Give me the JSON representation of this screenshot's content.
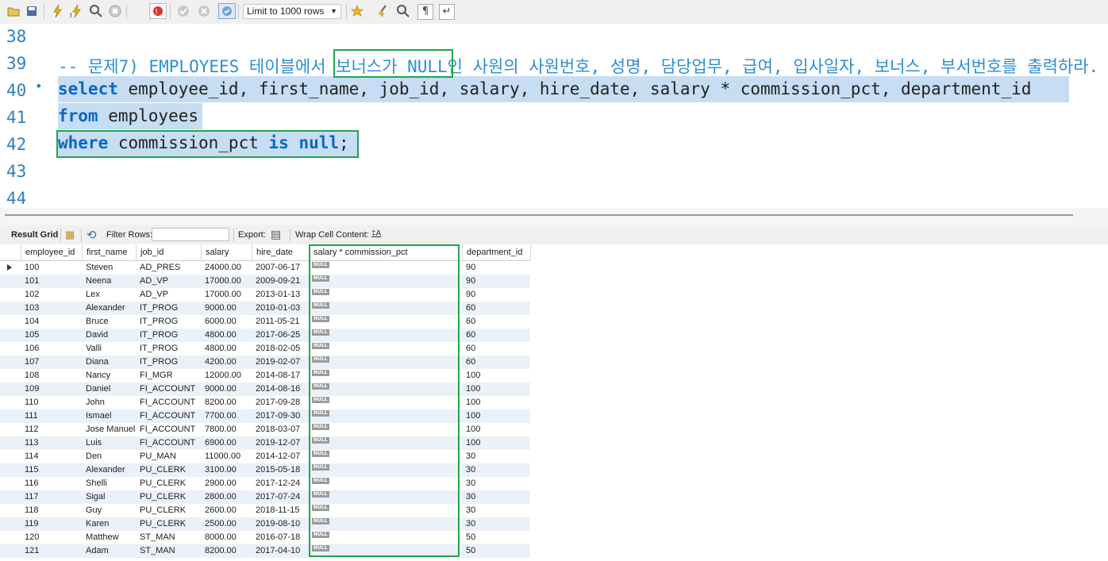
{
  "toolbar": {
    "limit_label": "Limit to 1000 rows",
    "icons": [
      "folder-open-icon",
      "save-icon",
      "execute-lightning-icon",
      "execute-cursor-lightning-icon",
      "explain-magnifier-icon",
      "stop-icon",
      "toggle-error-icon",
      "commit-check-icon",
      "rollback-x-icon",
      "autocommit-icon",
      "add-snippet-star-icon",
      "beautify-broom-icon",
      "find-icon",
      "invisible-chars-icon",
      "word-wrap-icon"
    ]
  },
  "editor": {
    "lines": [
      {
        "num": "38",
        "text": ""
      },
      {
        "num": "39",
        "text": "-- 문제7) EMPLOYEES 테이블에서 보너스가 NULL인 사원의 사원번호, 성명, 담당업무, 급여, 입사일자, 보너스, 부서번호를 출력하라."
      },
      {
        "num": "40",
        "kw": "select",
        "rest": " employee_id, first_name, job_id, salary, hire_date, salary * commission_pct, department_id"
      },
      {
        "num": "41",
        "kw": "from",
        "rest": " employees"
      },
      {
        "num": "42",
        "kw": "where",
        "mid": " commission_pct ",
        "kw2": "is",
        "sp": " ",
        "kw3": "null",
        "end": ";"
      },
      {
        "num": "43",
        "text": ""
      },
      {
        "num": "44",
        "text": ""
      }
    ]
  },
  "result_toolbar": {
    "result_grid": "Result Grid",
    "filter_rows": "Filter Rows:",
    "filter_value": "",
    "export": "Export:",
    "wrap": "Wrap Cell Content:"
  },
  "grid": {
    "columns": [
      "employee_id",
      "first_name",
      "job_id",
      "salary",
      "hire_date",
      "salary * commission_pct",
      "department_id"
    ],
    "null_label": "NULL",
    "rows": [
      [
        "100",
        "Steven",
        "AD_PRES",
        "24000.00",
        "2007-06-17",
        "90"
      ],
      [
        "101",
        "Neena",
        "AD_VP",
        "17000.00",
        "2009-09-21",
        "90"
      ],
      [
        "102",
        "Lex",
        "AD_VP",
        "17000.00",
        "2013-01-13",
        "90"
      ],
      [
        "103",
        "Alexander",
        "IT_PROG",
        "9000.00",
        "2010-01-03",
        "60"
      ],
      [
        "104",
        "Bruce",
        "IT_PROG",
        "6000.00",
        "2011-05-21",
        "60"
      ],
      [
        "105",
        "David",
        "IT_PROG",
        "4800.00",
        "2017-06-25",
        "60"
      ],
      [
        "106",
        "Valli",
        "IT_PROG",
        "4800.00",
        "2018-02-05",
        "60"
      ],
      [
        "107",
        "Diana",
        "IT_PROG",
        "4200.00",
        "2019-02-07",
        "60"
      ],
      [
        "108",
        "Nancy",
        "FI_MGR",
        "12000.00",
        "2014-08-17",
        "100"
      ],
      [
        "109",
        "Daniel",
        "FI_ACCOUNT",
        "9000.00",
        "2014-08-16",
        "100"
      ],
      [
        "110",
        "John",
        "FI_ACCOUNT",
        "8200.00",
        "2017-09-28",
        "100"
      ],
      [
        "111",
        "Ismael",
        "FI_ACCOUNT",
        "7700.00",
        "2017-09-30",
        "100"
      ],
      [
        "112",
        "Jose Manuel",
        "FI_ACCOUNT",
        "7800.00",
        "2018-03-07",
        "100"
      ],
      [
        "113",
        "Luis",
        "FI_ACCOUNT",
        "6900.00",
        "2019-12-07",
        "100"
      ],
      [
        "114",
        "Den",
        "PU_MAN",
        "11000.00",
        "2014-12-07",
        "30"
      ],
      [
        "115",
        "Alexander",
        "PU_CLERK",
        "3100.00",
        "2015-05-18",
        "30"
      ],
      [
        "116",
        "Shelli",
        "PU_CLERK",
        "2900.00",
        "2017-12-24",
        "30"
      ],
      [
        "117",
        "Sigal",
        "PU_CLERK",
        "2800.00",
        "2017-07-24",
        "30"
      ],
      [
        "118",
        "Guy",
        "PU_CLERK",
        "2600.00",
        "2018-11-15",
        "30"
      ],
      [
        "119",
        "Karen",
        "PU_CLERK",
        "2500.00",
        "2019-08-10",
        "30"
      ],
      [
        "120",
        "Matthew",
        "ST_MAN",
        "8000.00",
        "2016-07-18",
        "50"
      ],
      [
        "121",
        "Adam",
        "ST_MAN",
        "8200.00",
        "2017-04-10",
        "50"
      ]
    ]
  }
}
